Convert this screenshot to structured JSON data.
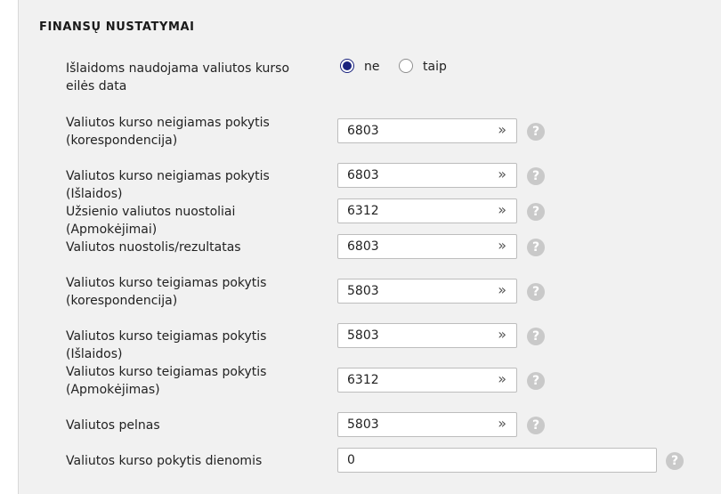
{
  "section_title": "FINANSŲ NUSTATYMAI",
  "expense_date_setting": {
    "label": "Išlaidoms naudojama valiutos kurso eilės data",
    "options": [
      {
        "label": "ne",
        "checked": true
      },
      {
        "label": "taip",
        "checked": false
      }
    ]
  },
  "fields": [
    {
      "label": "Valiutos kurso neigiamas pokytis (korespondencija)",
      "value": "6803",
      "has_picker": true,
      "has_help": true
    },
    {
      "label": "Valiutos kurso neigiamas pokytis (Išlaidos)",
      "value": "6803",
      "has_picker": true,
      "has_help": true
    },
    {
      "label": "Užsienio valiutos nuostoliai (Apmokėjimai)",
      "value": "6312",
      "has_picker": true,
      "has_help": true
    },
    {
      "label": "Valiutos nuostolis/rezultatas",
      "value": "6803",
      "has_picker": true,
      "has_help": true
    },
    {
      "label": "Valiutos kurso teigiamas pokytis (korespondencija)",
      "value": "5803",
      "has_picker": true,
      "has_help": true
    },
    {
      "label": "Valiutos kurso teigiamas pokytis (Išlaidos)",
      "value": "5803",
      "has_picker": true,
      "has_help": true
    },
    {
      "label": "Valiutos kurso teigiamas pokytis (Apmokėjimas)",
      "value": "6312",
      "has_picker": true,
      "has_help": true
    },
    {
      "label": "Valiutos pelnas",
      "value": "5803",
      "has_picker": true,
      "has_help": true
    },
    {
      "label": "Valiutos kurso pokytis dienomis",
      "value": "0",
      "has_picker": false,
      "has_help": true
    }
  ],
  "icons": {
    "picker": "double-chevron-right-icon",
    "help": "question-mark-circle-icon"
  },
  "glyphs": {
    "picker": "»",
    "help": "?"
  },
  "colors": {
    "panel_bg": "#f1f1f1",
    "radio_checked": "#1a237e",
    "help_icon_bg": "#c9c9c9"
  }
}
